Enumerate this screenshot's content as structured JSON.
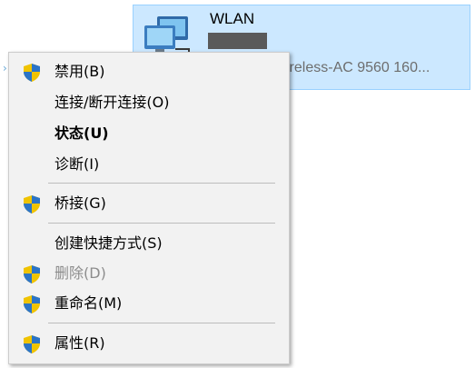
{
  "adapter": {
    "name": "WLAN",
    "description": "ireless-AC 9560 160..."
  },
  "menu": {
    "items": [
      {
        "label": "禁用(B)",
        "icon": "uac-shield-icon",
        "bold": false,
        "disabled": false
      },
      {
        "label": "连接/断开连接(O)",
        "icon": "",
        "bold": false,
        "disabled": false
      },
      {
        "label": "状态(U)",
        "icon": "",
        "bold": true,
        "disabled": false
      },
      {
        "label": "诊断(I)",
        "icon": "",
        "bold": false,
        "disabled": false
      },
      {
        "label": "桥接(G)",
        "icon": "uac-shield-icon",
        "bold": false,
        "disabled": false
      },
      {
        "label": "创建快捷方式(S)",
        "icon": "",
        "bold": false,
        "disabled": false
      },
      {
        "label": "删除(D)",
        "icon": "uac-shield-icon",
        "bold": false,
        "disabled": true
      },
      {
        "label": "重命名(M)",
        "icon": "uac-shield-icon",
        "bold": false,
        "disabled": false
      },
      {
        "label": "属性(R)",
        "icon": "uac-shield-icon",
        "bold": false,
        "disabled": false
      }
    ]
  },
  "colors": {
    "selection_bg": "#cce8ff",
    "menu_bg": "#f2f2f2",
    "disabled_text": "#8c8c8c"
  }
}
